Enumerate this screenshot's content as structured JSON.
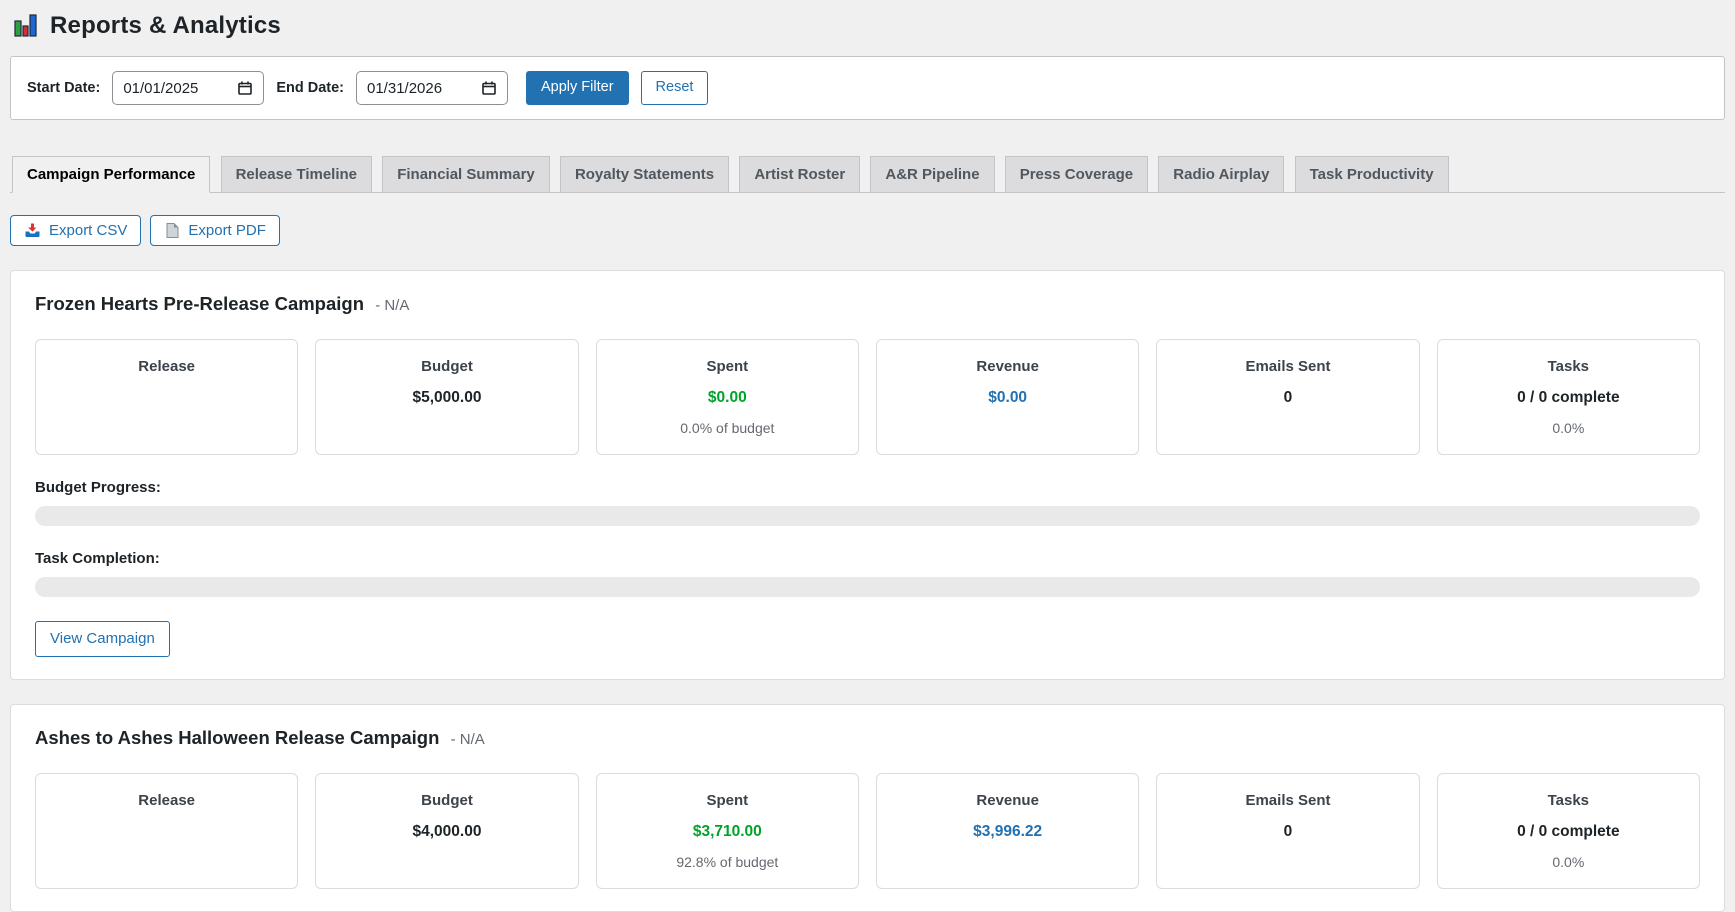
{
  "page": {
    "title": "Reports & Analytics"
  },
  "colors": {
    "accent_blue": "#2271b1",
    "positive_green": "#00a32a",
    "page_background": "#f0f0f1",
    "inactive_tab": "#dcdcde"
  },
  "filter": {
    "start_label": "Start Date:",
    "start_value": "01/01/2025",
    "end_label": "End Date:",
    "end_value": "01/31/2026",
    "apply_label": "Apply Filter",
    "reset_label": "Reset"
  },
  "tabs": [
    {
      "label": "Campaign Performance",
      "active": true
    },
    {
      "label": "Release Timeline",
      "active": false
    },
    {
      "label": "Financial Summary",
      "active": false
    },
    {
      "label": "Royalty Statements",
      "active": false
    },
    {
      "label": "Artist Roster",
      "active": false
    },
    {
      "label": "A&R Pipeline",
      "active": false
    },
    {
      "label": "Press Coverage",
      "active": false
    },
    {
      "label": "Radio Airplay",
      "active": false
    },
    {
      "label": "Task Productivity",
      "active": false
    }
  ],
  "export": {
    "csv_label": "Export CSV",
    "pdf_label": "Export PDF"
  },
  "campaigns": [
    {
      "title": "Frozen Hearts Pre-Release Campaign",
      "subtitle": "- N/A",
      "stats": [
        {
          "label": "Release"
        },
        {
          "label": "Budget",
          "value": "$5,000.00"
        },
        {
          "label": "Spent",
          "value": "$0.00",
          "sub": "0.0% of budget"
        },
        {
          "label": "Revenue",
          "value": "$0.00"
        },
        {
          "label": "Emails Sent",
          "value": "0"
        },
        {
          "label": "Tasks",
          "value": "0 / 0 complete",
          "sub": "0.0%"
        }
      ],
      "budget_progress_label": "Budget Progress:",
      "budget_progress_pct": 0,
      "task_completion_label": "Task Completion:",
      "task_completion_pct": 0,
      "view_button": "View Campaign"
    },
    {
      "title": "Ashes to Ashes Halloween Release Campaign",
      "subtitle": "- N/A",
      "stats": [
        {
          "label": "Release"
        },
        {
          "label": "Budget",
          "value": "$4,000.00"
        },
        {
          "label": "Spent",
          "value": "$3,710.00",
          "sub": "92.8% of budget"
        },
        {
          "label": "Revenue",
          "value": "$3,996.22"
        },
        {
          "label": "Emails Sent",
          "value": "0"
        },
        {
          "label": "Tasks",
          "value": "0 / 0 complete",
          "sub": "0.0%"
        }
      ]
    }
  ]
}
